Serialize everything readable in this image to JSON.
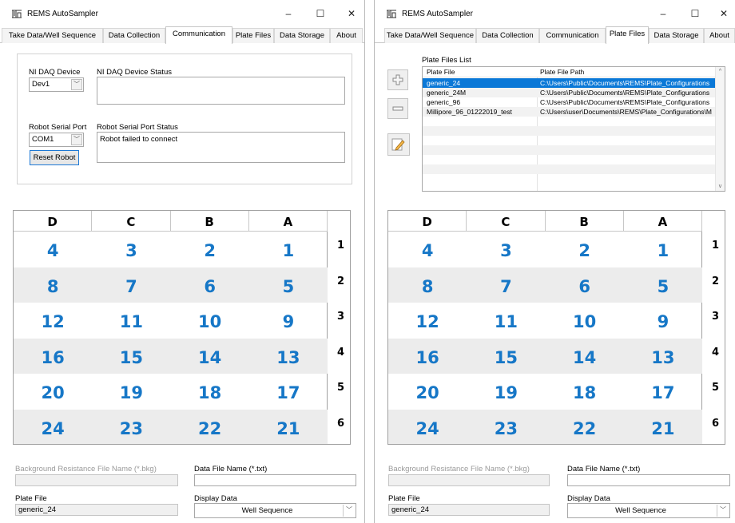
{
  "app": {
    "title": "REMS AutoSampler"
  },
  "window_controls": {
    "minimize": "–",
    "maximize": "☐",
    "close": "✕"
  },
  "tabs": [
    "Take Data/Well Sequence",
    "Data Collection",
    "Communication",
    "Plate Files",
    "Data Storage",
    "About"
  ],
  "left_window": {
    "active_tab": "Communication"
  },
  "right_window": {
    "active_tab": "Plate Files"
  },
  "communication": {
    "ni_daq_device_label": "NI DAQ Device",
    "ni_daq_device_value": "Dev1",
    "ni_daq_status_label": "NI DAQ Device Status",
    "ni_daq_status_text": "",
    "robot_serial_port_label": "Robot Serial Port",
    "robot_serial_port_value": "COM1",
    "robot_status_label": "Robot Serial Port Status",
    "robot_status_text": "Robot failed to connect",
    "reset_robot_button": "Reset Robot"
  },
  "plate_files": {
    "list_label": "Plate Files List",
    "columns": [
      "Plate File",
      "Plate File Path"
    ],
    "rows": [
      {
        "file": "generic_24",
        "path": "C:\\Users\\Public\\Documents\\REMS\\Plate_Configurations",
        "selected": true
      },
      {
        "file": "generic_24M",
        "path": "C:\\Users\\Public\\Documents\\REMS\\Plate_Configurations",
        "selected": false
      },
      {
        "file": "generic_96",
        "path": "C:\\Users\\Public\\Documents\\REMS\\Plate_Configurations",
        "selected": false
      },
      {
        "file": "Millipore_96_01222019_test",
        "path": "C:\\Users\\user\\Documents\\REMS\\Plate_Configurations\\M",
        "selected": false
      }
    ],
    "tool_icons": [
      "add-icon",
      "remove-icon",
      "edit-icon"
    ]
  },
  "plate": {
    "columns": [
      "D",
      "C",
      "B",
      "A"
    ],
    "row_labels": [
      "1",
      "2",
      "3",
      "4",
      "5",
      "6"
    ],
    "wells": [
      [
        "4",
        "3",
        "2",
        "1"
      ],
      [
        "8",
        "7",
        "6",
        "5"
      ],
      [
        "12",
        "11",
        "10",
        "9"
      ],
      [
        "16",
        "15",
        "14",
        "13"
      ],
      [
        "20",
        "19",
        "18",
        "17"
      ],
      [
        "24",
        "23",
        "22",
        "21"
      ]
    ]
  },
  "bottom": {
    "bkg_label": "Background Resistance File Name (*.bkg)",
    "bkg_value": "",
    "data_file_label": "Data File Name (*.txt)",
    "data_file_value": "",
    "plate_file_label": "Plate File",
    "plate_file_value": "generic_24",
    "display_data_label": "Display Data",
    "display_data_value": "Well Sequence"
  },
  "colors": {
    "accent": "#0A78D7",
    "well_number": "#1677C7",
    "alt_row": "#ECECEC"
  }
}
